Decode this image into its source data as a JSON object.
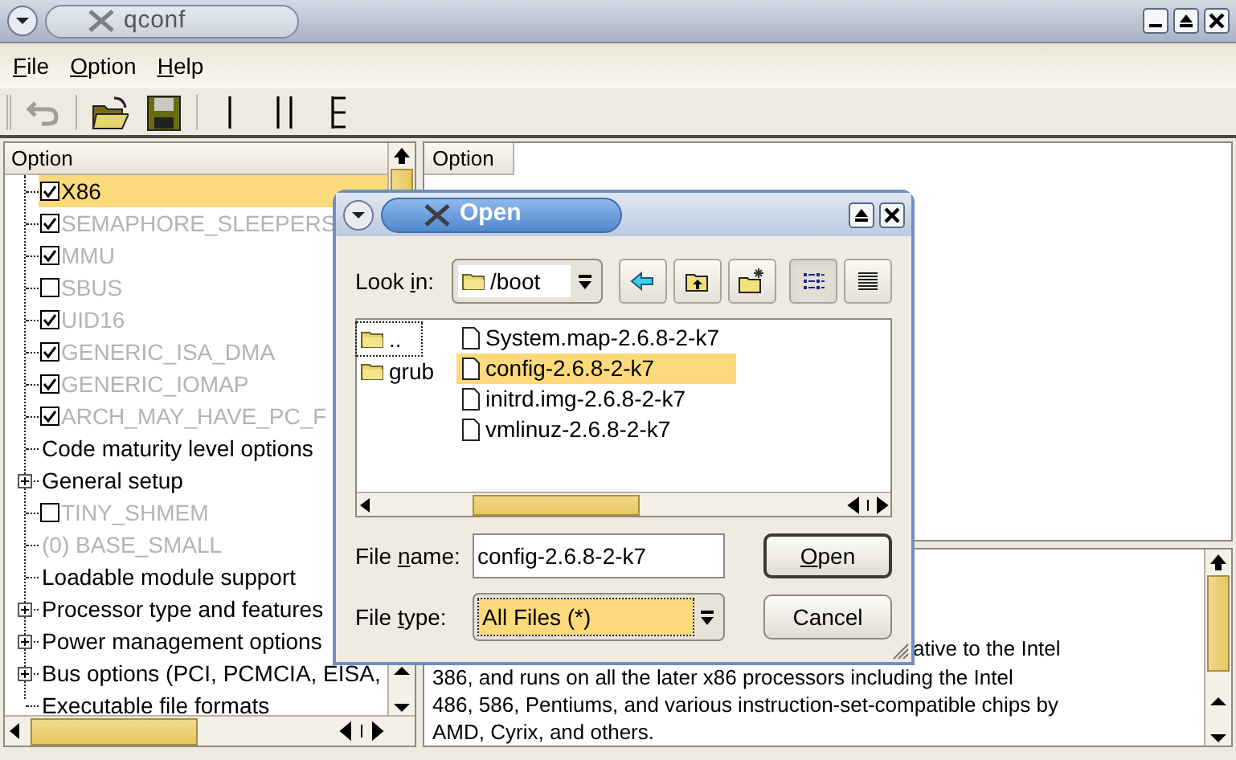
{
  "window": {
    "title": "qconf"
  },
  "menu": [
    {
      "key": "F",
      "post": "ile"
    },
    {
      "key": "O",
      "post": "ption"
    },
    {
      "key": "H",
      "post": "elp"
    }
  ],
  "toolbar": [
    {
      "kind": "undo",
      "disabled": true
    },
    {
      "kind": "open",
      "disabled": false
    },
    {
      "kind": "save",
      "disabled": false
    },
    {
      "kind": "single",
      "disabled": false
    },
    {
      "kind": "split",
      "disabled": false
    },
    {
      "kind": "full",
      "disabled": false
    }
  ],
  "tree": {
    "header": "Option",
    "items": [
      {
        "kind": "bool",
        "label": "X86",
        "checked": true,
        "disabled": false,
        "collapsed": false,
        "selected": true
      },
      {
        "kind": "bool",
        "label": "SEMAPHORE_SLEEPERS",
        "checked": true,
        "disabled": true,
        "collapsed": false,
        "selected": false
      },
      {
        "kind": "bool",
        "label": "MMU",
        "checked": true,
        "disabled": true,
        "collapsed": false,
        "selected": false
      },
      {
        "kind": "bool",
        "label": "SBUS",
        "checked": false,
        "disabled": true,
        "collapsed": false,
        "selected": false
      },
      {
        "kind": "bool",
        "label": "UID16",
        "checked": true,
        "disabled": true,
        "collapsed": false,
        "selected": false
      },
      {
        "kind": "bool",
        "label": "GENERIC_ISA_DMA",
        "checked": true,
        "disabled": true,
        "collapsed": false,
        "selected": false
      },
      {
        "kind": "bool",
        "label": "GENERIC_IOMAP",
        "checked": true,
        "disabled": true,
        "collapsed": false,
        "selected": false
      },
      {
        "kind": "bool",
        "label": "ARCH_MAY_HAVE_PC_F",
        "checked": true,
        "disabled": true,
        "collapsed": false,
        "selected": false
      },
      {
        "kind": "menu",
        "label": "Code maturity level options",
        "disabled": false,
        "collapsed": false,
        "selected": false
      },
      {
        "kind": "menu",
        "label": "General setup",
        "disabled": false,
        "collapsed": true,
        "selected": false
      },
      {
        "kind": "bool",
        "label": "TINY_SHMEM",
        "checked": false,
        "disabled": true,
        "collapsed": false,
        "selected": false
      },
      {
        "kind": "value",
        "label": "(0) BASE_SMALL",
        "disabled": true,
        "collapsed": false,
        "selected": false
      },
      {
        "kind": "menu",
        "label": "Loadable module support",
        "disabled": false,
        "collapsed": false,
        "selected": false
      },
      {
        "kind": "menu",
        "label": "Processor type and features",
        "disabled": false,
        "collapsed": true,
        "selected": false
      },
      {
        "kind": "menu",
        "label": "Power management options",
        "disabled": false,
        "collapsed": true,
        "selected": false
      },
      {
        "kind": "menu",
        "label": "Bus options (PCI, PCMCIA, EISA,",
        "disabled": false,
        "collapsed": true,
        "selected": false
      },
      {
        "kind": "menu",
        "label": "Executable file formats",
        "disabled": false,
        "collapsed": false,
        "selected": false
      }
    ]
  },
  "options_panel": {
    "header": "Option"
  },
  "help": {
    "lines": [
      "ative to the Intel",
      "386, and runs on all the later x86 processors including the Intel",
      "486, 586, Pentiums, and various instruction-set-compatible chips by",
      "AMD, Cyrix, and others."
    ]
  },
  "dialog": {
    "title": "Open",
    "look_in": {
      "label": {
        "pre": "Look ",
        "key": "i",
        "post": "n:"
      },
      "value": "/boot"
    },
    "nav_buttons": [
      {
        "kind": "back",
        "selected": false
      },
      {
        "kind": "up",
        "selected": false
      },
      {
        "kind": "new_folder",
        "selected": false
      },
      {
        "kind": "list",
        "selected": true
      },
      {
        "kind": "detail",
        "selected": false
      }
    ],
    "folders": [
      {
        "name": "..",
        "focused": true
      },
      {
        "name": "grub",
        "focused": false
      }
    ],
    "files": [
      {
        "name": "System.map-2.6.8-2-k7",
        "selected": false
      },
      {
        "name": "config-2.6.8-2-k7",
        "selected": true
      },
      {
        "name": "initrd.img-2.6.8-2-k7",
        "selected": false
      },
      {
        "name": "vmlinuz-2.6.8-2-k7",
        "selected": false
      }
    ],
    "file_name": {
      "label": {
        "pre": "File ",
        "key": "n",
        "post": "ame:"
      },
      "value": "config-2.6.8-2-k7"
    },
    "file_type": {
      "label": {
        "pre": "File ",
        "key": "t",
        "post": "ype:"
      },
      "value": "All Files (*)"
    },
    "buttons": [
      {
        "label": {
          "key": "O",
          "post": "pen"
        },
        "default": true
      },
      {
        "label": {
          "pre": "Cancel"
        },
        "default": false
      }
    ]
  }
}
